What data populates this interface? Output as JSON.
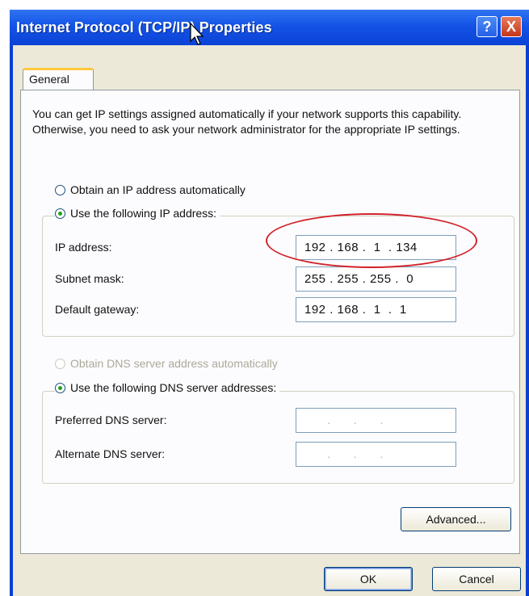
{
  "window": {
    "title": "Internet Protocol (TCP/IP) Properties",
    "help_label": "?",
    "close_label": "X"
  },
  "tabs": [
    {
      "label": "General"
    }
  ],
  "intro_text": "You can get IP settings assigned automatically if your network supports this capability. Otherwise, you need to ask your network administrator for the appropriate IP settings.",
  "ip_section": {
    "auto_option": "Obtain an IP address automatically",
    "manual_option": "Use the following IP address:",
    "ip_label": "IP address:",
    "ip_value": "192 . 168 .  1  . 134",
    "subnet_label": "Subnet mask:",
    "subnet_value": "255 . 255 . 255 .  0",
    "gateway_label": "Default gateway:",
    "gateway_value": "192 . 168 .  1  .  1"
  },
  "dns_section": {
    "auto_option": "Obtain DNS server address automatically",
    "manual_option": "Use the following DNS server addresses:",
    "preferred_label": "Preferred DNS server:",
    "preferred_value": "      .      .      .",
    "alternate_label": "Alternate DNS server:",
    "alternate_value": "      .      .      ."
  },
  "buttons": {
    "advanced": "Advanced...",
    "ok": "OK",
    "cancel": "Cancel"
  },
  "colors": {
    "annotation": "#d2232a",
    "titlebar": "#0b43d6"
  }
}
